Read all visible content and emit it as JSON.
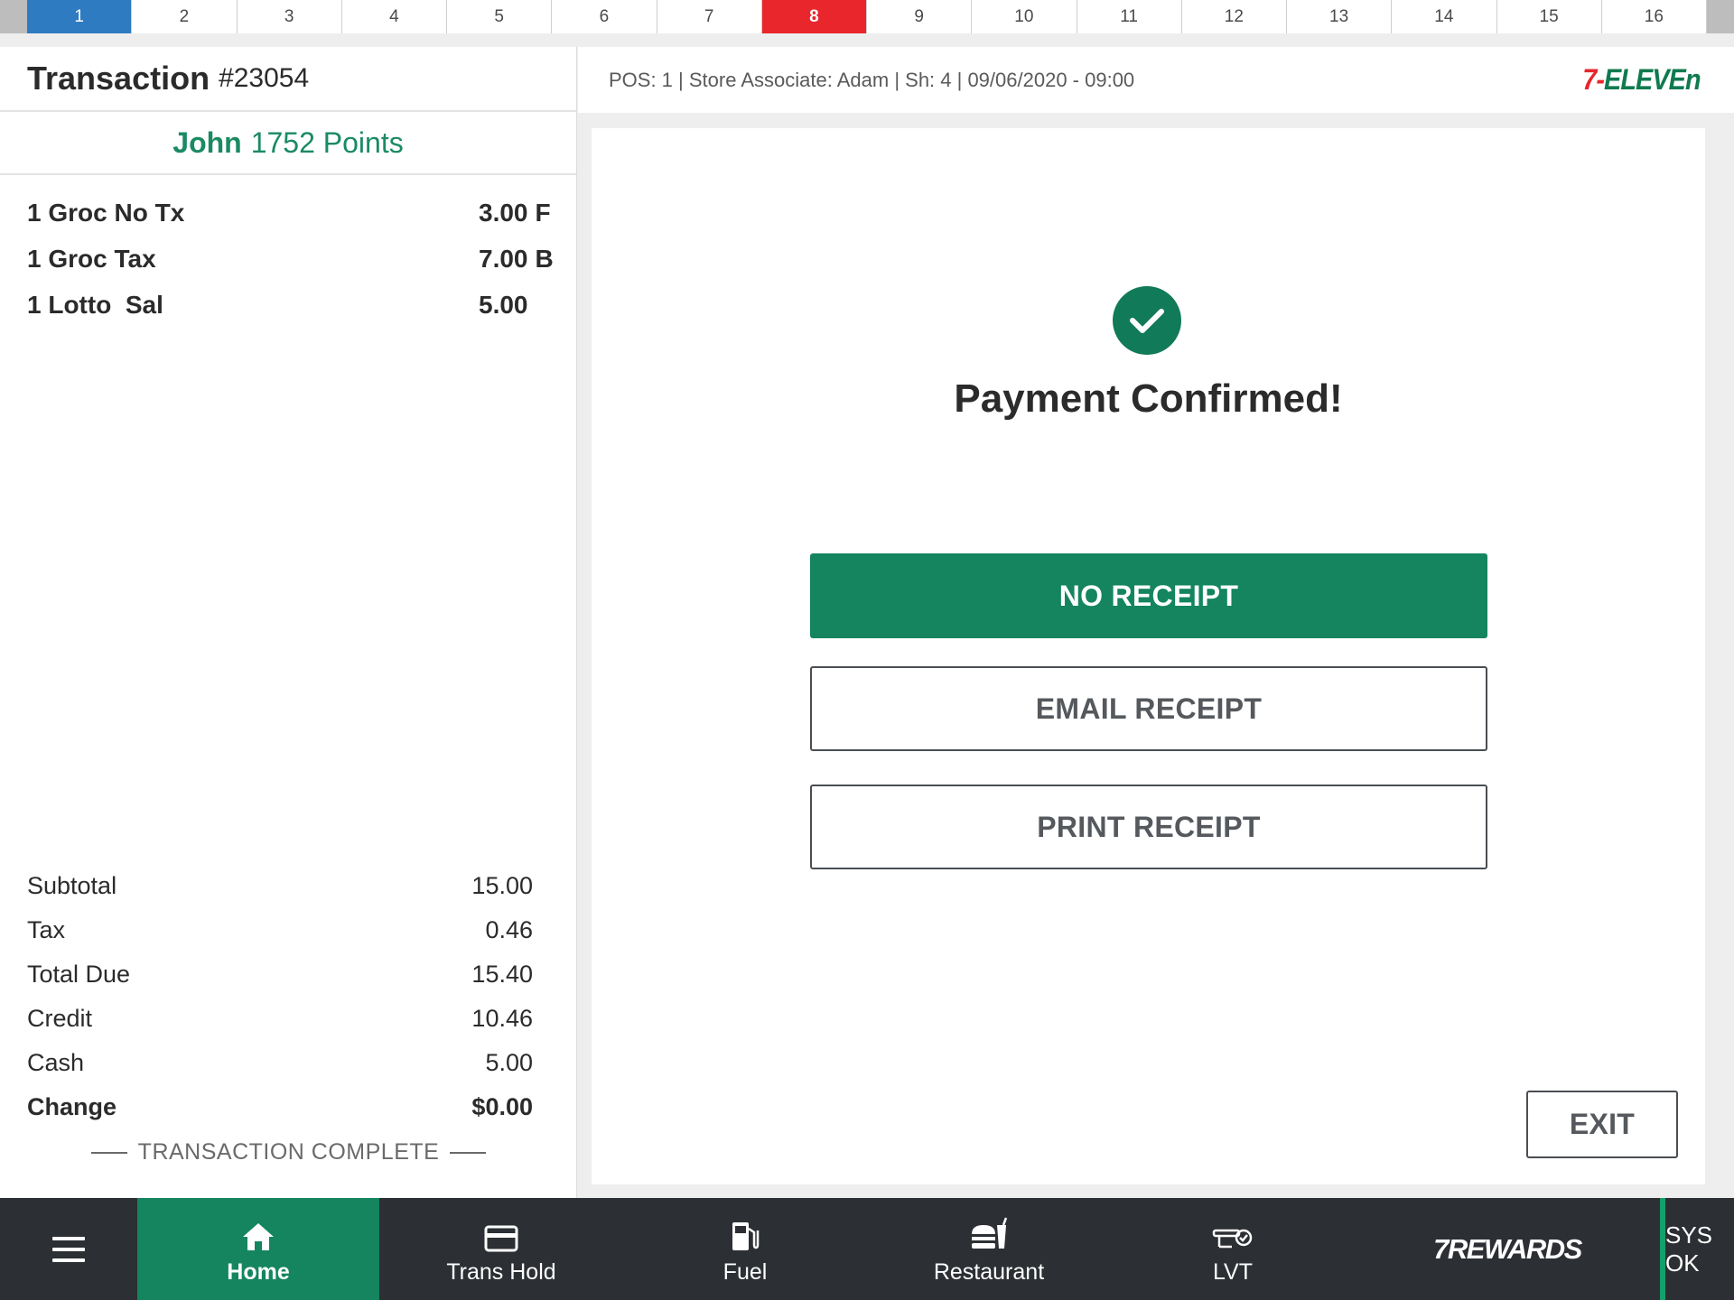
{
  "tabs": [
    {
      "label": "1",
      "state": "active"
    },
    {
      "label": "2",
      "state": "normal"
    },
    {
      "label": "3",
      "state": "normal"
    },
    {
      "label": "4",
      "state": "normal"
    },
    {
      "label": "5",
      "state": "normal"
    },
    {
      "label": "6",
      "state": "normal"
    },
    {
      "label": "7",
      "state": "normal"
    },
    {
      "label": "8",
      "state": "alert"
    },
    {
      "label": "9",
      "state": "normal"
    },
    {
      "label": "10",
      "state": "normal"
    },
    {
      "label": "11",
      "state": "normal"
    },
    {
      "label": "12",
      "state": "normal"
    },
    {
      "label": "13",
      "state": "normal"
    },
    {
      "label": "14",
      "state": "normal"
    },
    {
      "label": "15",
      "state": "normal"
    },
    {
      "label": "16",
      "state": "normal"
    }
  ],
  "transaction": {
    "title": "Transaction",
    "number": "#23054",
    "customer_name": "John",
    "customer_points": "1752 Points",
    "items": [
      {
        "desc": "1 Groc No Tx",
        "amount": "3.00",
        "flag": "F"
      },
      {
        "desc": "1 Groc Tax",
        "amount": "7.00",
        "flag": "B"
      },
      {
        "desc": "1 Lotto  Sal",
        "amount": "5.00",
        "flag": ""
      }
    ],
    "totals": [
      {
        "label": "Subtotal",
        "value": "15.00"
      },
      {
        "label": "Tax",
        "value": "0.46"
      },
      {
        "label": "Total Due",
        "value": "15.40"
      },
      {
        "label": "Credit",
        "value": "10.46"
      },
      {
        "label": "Cash",
        "value": "5.00"
      }
    ],
    "change_label": "Change",
    "change_value": "$0.00",
    "status": "TRANSACTION COMPLETE"
  },
  "header": {
    "info": "POS: 1 | Store Associate: Adam | Sh: 4 | 09/06/2020 - 09:00",
    "brand_seven": "7-",
    "brand_eleven": "ELEVEn"
  },
  "main": {
    "confirm_icon": "check-circle-icon",
    "title": "Payment Confirmed!",
    "no_receipt": "NO RECEIPT",
    "email_receipt": "EMAIL RECEIPT",
    "print_receipt": "PRINT RECEIPT",
    "exit": "EXIT"
  },
  "nav": {
    "home": "Home",
    "trans_hold": "Trans Hold",
    "fuel": "Fuel",
    "restaurant": "Restaurant",
    "lvt": "LVT",
    "rewards": "7REWARDS",
    "sys_status": "SYS OK"
  },
  "colors": {
    "accent_green": "#14855f",
    "tab_active_blue": "#2f7bc1",
    "tab_alert_red": "#e8262b",
    "nav_background": "#2c2f33",
    "customer_green": "#1b8a63"
  }
}
